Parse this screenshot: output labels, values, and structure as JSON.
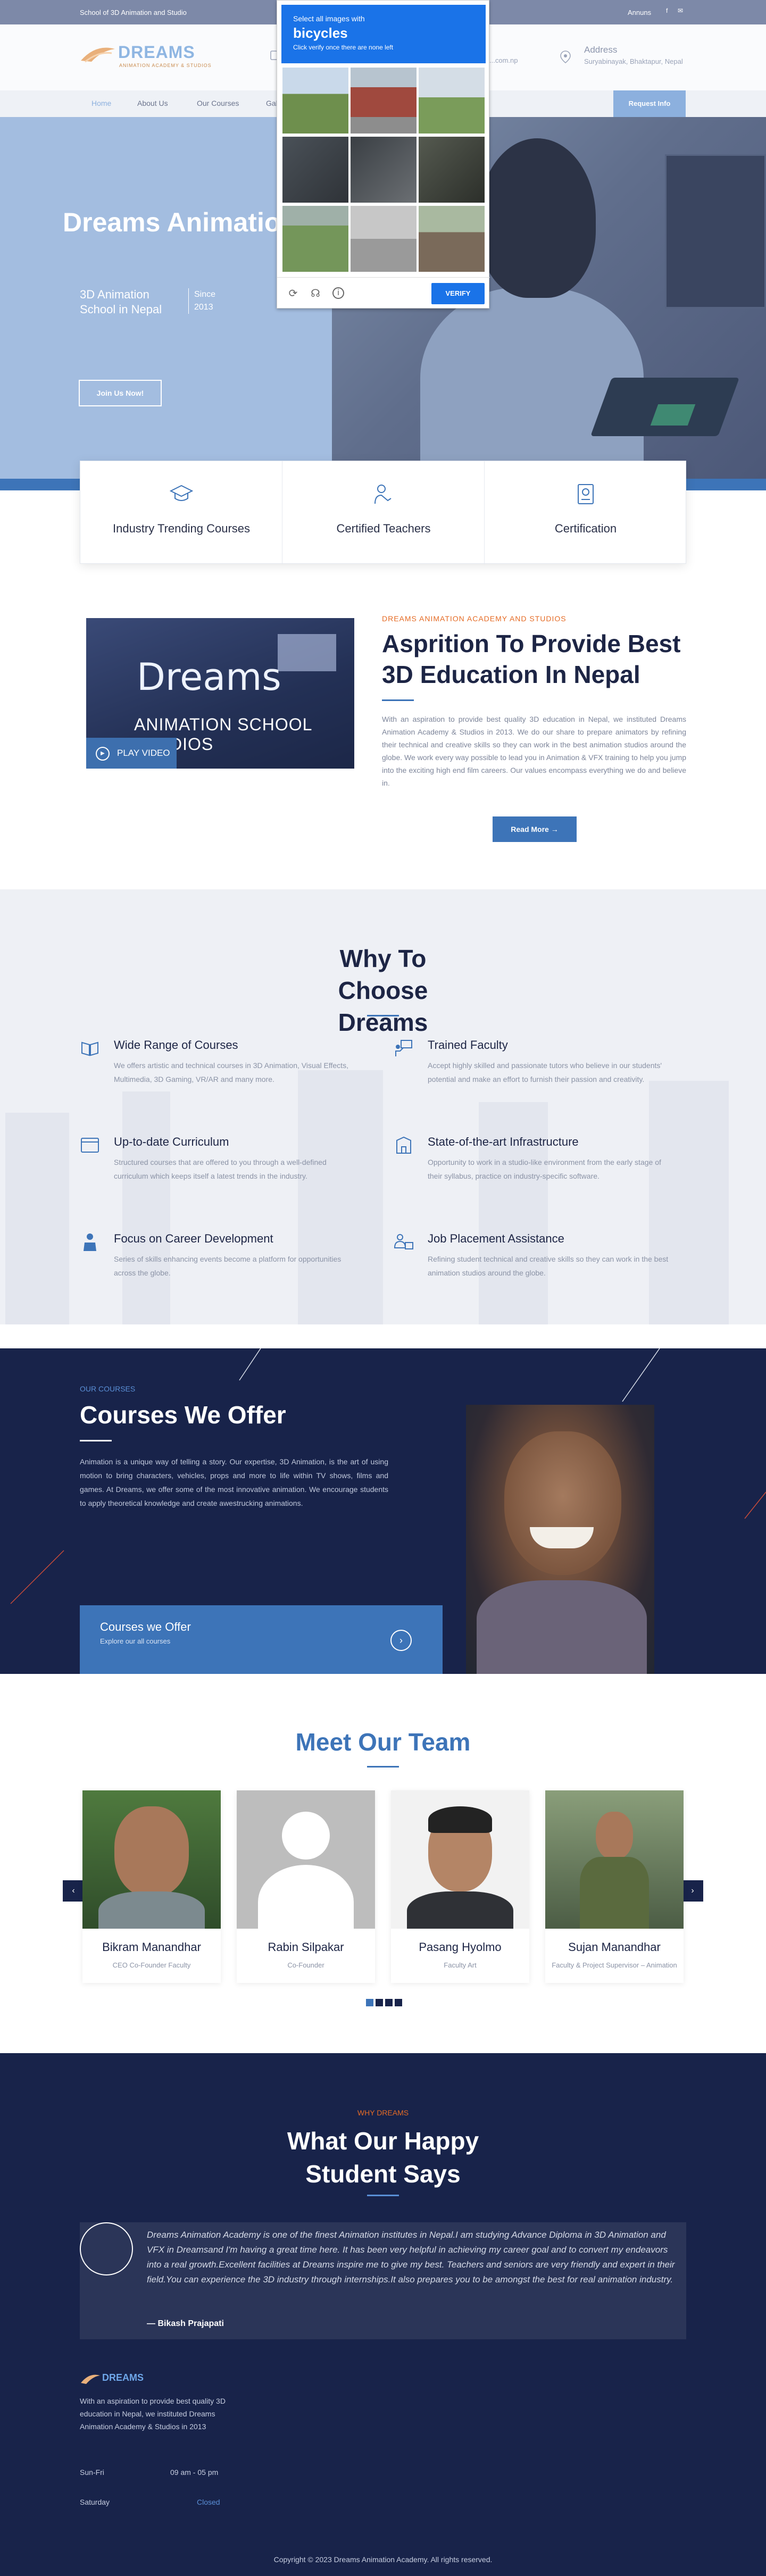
{
  "topbar": {
    "left": "School of 3D Animation and Studio",
    "right": "Annuns",
    "social": [
      "f",
      "✉"
    ]
  },
  "header": {
    "logo": {
      "name": "DREAMS",
      "tagline": "ANIMATION ACADEMY & STUDIOS"
    },
    "contact_fragment": "...com.np",
    "address": {
      "title": "Address",
      "value": "Suryabinayak, Bhaktapur, Nepal"
    }
  },
  "nav": {
    "items": [
      "Home",
      "About Us",
      "Our Courses",
      "Gallery"
    ],
    "cta": "Request Info"
  },
  "hero": {
    "title": "Dreams Animation Academy and Studios",
    "subtitle": "3D Animation School in Nepal",
    "since": "Since 2013",
    "button": "Join Us Now!"
  },
  "captcha": {
    "line1": "Select all images with",
    "keyword": "bicycles",
    "line3": "Click verify once there are none left",
    "verify": "VERIFY",
    "icons": [
      "reload-icon",
      "audio-icon",
      "info-icon"
    ]
  },
  "features": [
    {
      "label": "Industry Trending Courses",
      "icon": "graduation-cap-icon"
    },
    {
      "label": "Certified Teachers",
      "icon": "certified-teacher-icon"
    },
    {
      "label": "Certification",
      "icon": "certificate-icon"
    }
  ],
  "about": {
    "image_text": {
      "brand": "Dreams",
      "line": "ANIMATION SCHOOL STUDIOS"
    },
    "play": "PLAY VIDEO",
    "kicker": "DREAMS ANIMATION ACADEMY AND STUDIOS",
    "title": "Asprition To Provide Best 3D Education In Nepal",
    "body": "With an aspiration to provide best quality 3D education in Nepal, we instituted Dreams Animation Academy & Studios in 2013. We do our share to prepare animators by refining their technical and creative skills so they can work in the best animation studios around the globe. We work every way possible to lead you in Animation & VFX training to help you jump into the exciting high end film careers. Our values encompass everything we do and believe in.",
    "button": "Read More"
  },
  "why": {
    "title": "Why To Choose Dreams",
    "items": [
      {
        "title": "Wide Range of Courses",
        "desc": "We offers artistic and technical courses in 3D Animation, Visual Effects, Multimedia, 3D Gaming, VR/AR and many more.",
        "icon": "book-icon"
      },
      {
        "title": "Trained Faculty",
        "desc": "Accept highly skilled and passionate tutors who believe in our students' potential and make an effort to furnish their passion and creativity.",
        "icon": "teacher-board-icon"
      },
      {
        "title": "Up-to-date Curriculum",
        "desc": "Structured courses that are offered to you through a well-defined curriculum which keeps itself a latest trends in the industry.",
        "icon": "browser-window-icon"
      },
      {
        "title": "State-of-the-art Infrastructure",
        "desc": "Opportunity to work in a studio-like environment from the early stage of their syllabus, practice on industry-specific software.",
        "icon": "building-icon"
      },
      {
        "title": "Focus on Career Development",
        "desc": "Series of skills enhancing events become a platform for opportunities across the globe.",
        "icon": "career-icon"
      },
      {
        "title": "Job Placement Assistance",
        "desc": "Refining student technical and creative skills so they can work in the best animation studios around the globe.",
        "icon": "placement-icon"
      }
    ]
  },
  "courses": {
    "kicker": "OUR COURSES",
    "title": "Courses We Offer",
    "body": "Animation is a unique way of telling a story. Our expertise, 3D Animation, is the art of using motion to bring characters, vehicles, props and more to life within TV shows, films and games. At Dreams, we offer some of the most innovative animation. We encourage students to apply theoretical knowledge and create awestrucking animations.",
    "box_title": "Courses we Offer",
    "box_sub": "Explore our all courses"
  },
  "team": {
    "title": "Meet Our Team",
    "members": [
      {
        "name": "Bikram Manandhar",
        "role": "CEO Co-Founder Faculty"
      },
      {
        "name": "Rabin Silpakar",
        "role": "Co-Founder"
      },
      {
        "name": "Pasang Hyolmo",
        "role": "Faculty Art"
      },
      {
        "name": "Sujan Manandhar",
        "role": "Faculty & Project Supervisor – Animation"
      }
    ],
    "prev": "‹",
    "next": "›"
  },
  "testimonial": {
    "kicker": "WHY DREAMS",
    "title": "What Our Happy Student Says",
    "quote": "Dreams Animation Academy is one of the finest Animation institutes in Nepal.I am studying Advance Diploma in 3D Animation and VFX in Dreamsand I'm having a great time here. It has been very helpful in achieving my career goal and to convert my endeavors into a real growth.Excellent facilities at Dreams inspire me to give my best. Teachers and seniors are very friendly and expert in their field.You can experience the 3D industry through internships.It also prepares you to be amongst the best for real animation industry.",
    "author": "— Bikash Prajapati"
  },
  "footer": {
    "logo": "DREAMS",
    "desc": "With an aspiration to provide best quality 3D education in Nepal, we instituted Dreams Animation Academy & Studios in 2013",
    "hours": [
      {
        "day": "Sun-Fri",
        "time": "09 am - 05 pm"
      },
      {
        "day": "Saturday",
        "time": "Closed"
      }
    ],
    "copyright": "Copyright © 2023 Dreams Animation Academy. All rights reserved."
  },
  "colors": {
    "primary": "#3d74b8",
    "navy": "#18234a",
    "accent": "#e56b25",
    "captcha": "#1a73e8"
  }
}
